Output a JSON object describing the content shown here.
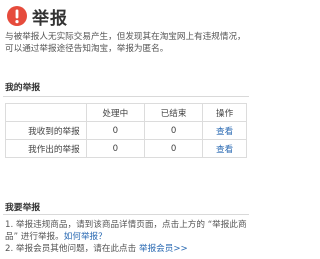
{
  "header": {
    "title": "举报",
    "icon": "alert-icon",
    "icon_color": "#e64b3c"
  },
  "intro": {
    "text": "与被举报人无实际交易产生，但发现其在淘宝网上有违规情况，可以通过举报途径告知淘宝，举报为匿名。"
  },
  "my_reports": {
    "title": "我的举报",
    "columns": [
      "",
      "处理中",
      "已结束",
      "操作"
    ],
    "rows": [
      {
        "label": "我收到的举报",
        "processing": "0",
        "finished": "0",
        "action": "查看"
      },
      {
        "label": "我作出的举报",
        "processing": "0",
        "finished": "0",
        "action": "查看"
      }
    ]
  },
  "want_report": {
    "title": "我要举报",
    "item1_text": "1. 举报违规商品，请到该商品详情页面，点击上方的 “举报此商品” 进行举报。",
    "item1_link": "如何举报？",
    "item2_text": "2. 举报会员其他问题，请在此点击",
    "item2_link": "举报会员>>"
  },
  "colors": {
    "link": "#2a6ab3",
    "border": "#dcdcdc",
    "text": "#333333"
  }
}
